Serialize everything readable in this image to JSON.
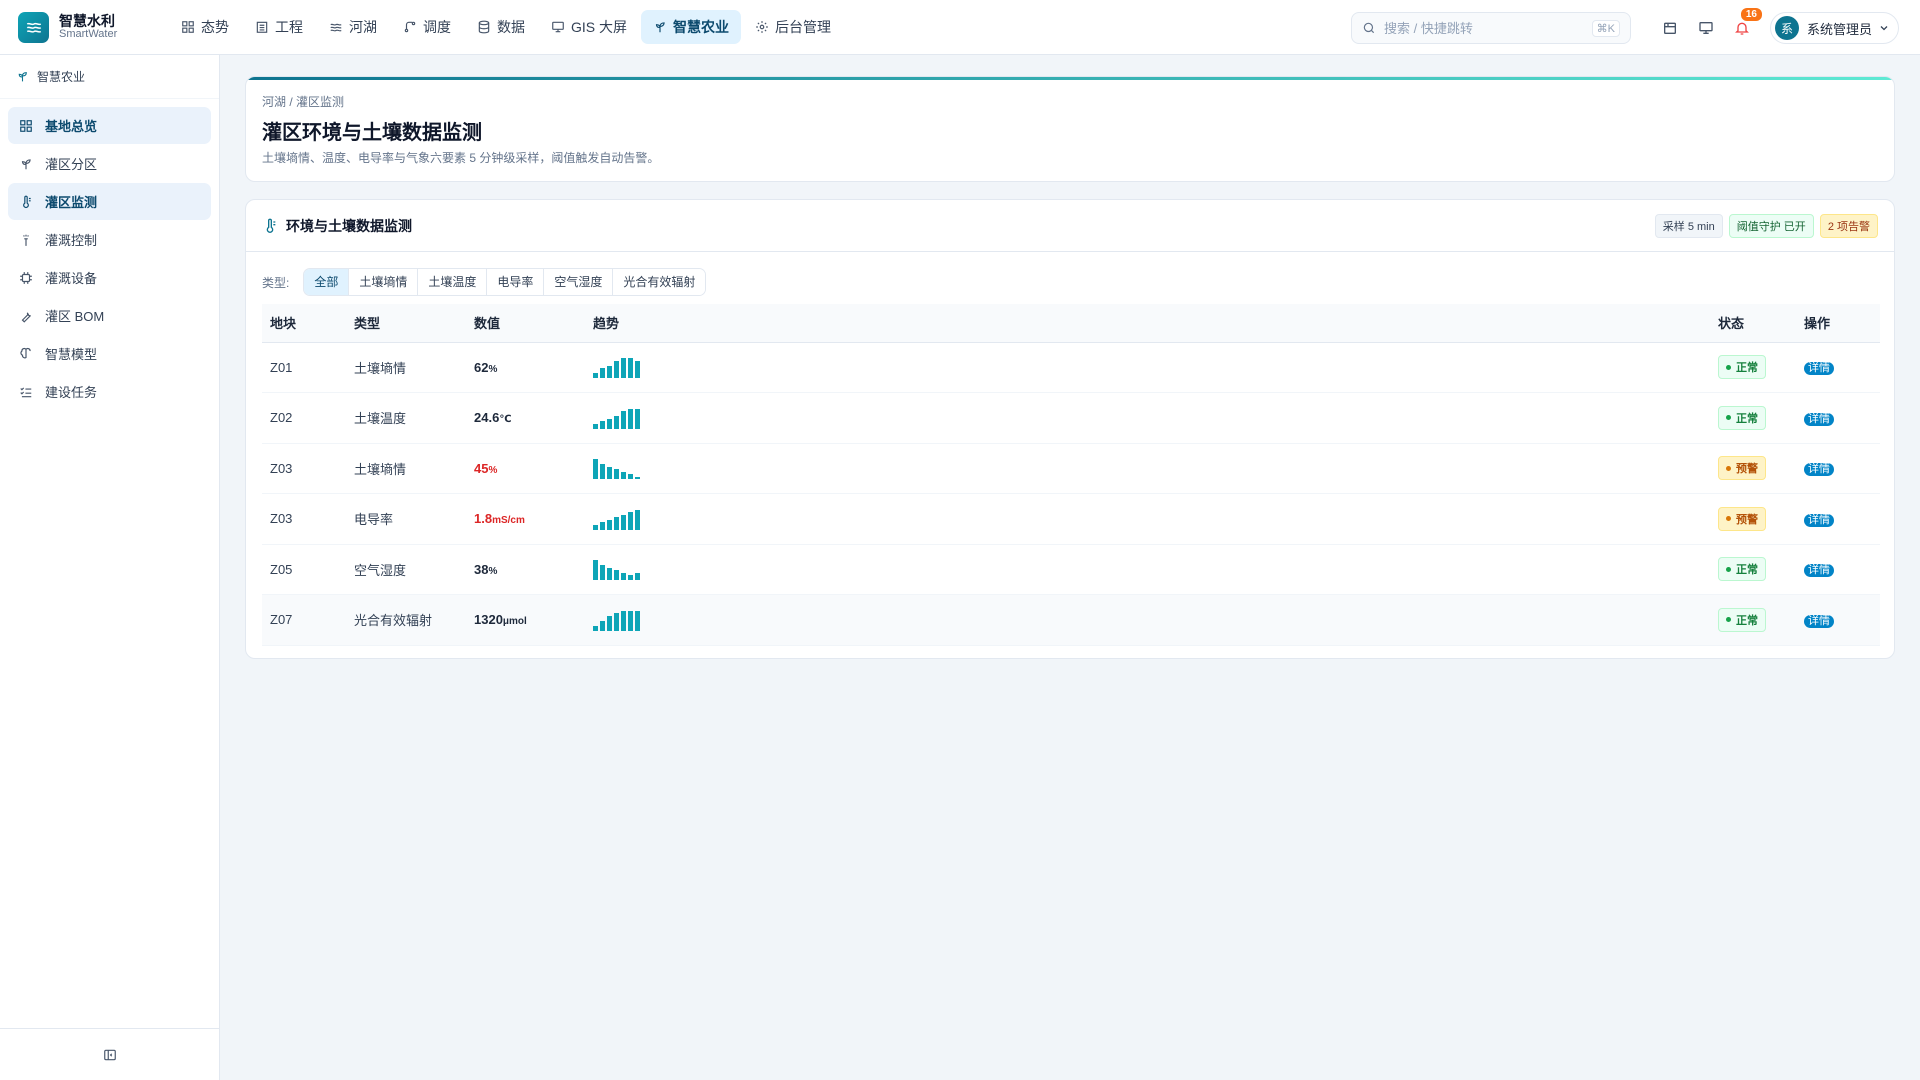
{
  "brand": {
    "title": "智慧水利",
    "subtitle": "SmartWater"
  },
  "nav": [
    {
      "label": "态势",
      "icon": "grid-icon"
    },
    {
      "label": "工程",
      "icon": "building-icon"
    },
    {
      "label": "河湖",
      "icon": "waves-icon"
    },
    {
      "label": "调度",
      "icon": "branch-icon"
    },
    {
      "label": "数据",
      "icon": "database-icon"
    },
    {
      "label": "GIS 大屏",
      "icon": "monitor-icon"
    },
    {
      "label": "智慧农业",
      "icon": "sprout-icon",
      "active": true
    },
    {
      "label": "后台管理",
      "icon": "gear-icon"
    }
  ],
  "search": {
    "placeholder": "搜索 / 快捷跳转",
    "shortcut": "⌘K"
  },
  "notifications": {
    "count": "16"
  },
  "user": {
    "avatar_text": "系",
    "name": "系统管理员"
  },
  "sidebar": {
    "header": "智慧农业",
    "items": [
      {
        "label": "基地总览",
        "active": true
      },
      {
        "label": "灌区分区"
      },
      {
        "label": "灌区监测",
        "active": true
      },
      {
        "label": "灌溉控制"
      },
      {
        "label": "灌溉设备"
      },
      {
        "label": "灌区 BOM"
      },
      {
        "label": "智慧模型"
      },
      {
        "label": "建设任务"
      }
    ]
  },
  "page": {
    "breadcrumb": "河湖 / 灌区监测",
    "title": "灌区环境与土壤数据监测",
    "description": "土壤墒情、温度、电导率与气象六要素 5 分钟级采样，阈值触发自动告警。"
  },
  "panel": {
    "title": "环境与土壤数据监测",
    "tags": [
      {
        "label": "采样 5 min",
        "tone": "gray"
      },
      {
        "label": "阈值守护 已开",
        "tone": "green"
      },
      {
        "label": "2 项告警",
        "tone": "orange"
      }
    ],
    "filter_label": "类型:",
    "filters": [
      {
        "label": "全部",
        "active": true
      },
      {
        "label": "土壤墒情"
      },
      {
        "label": "土壤温度"
      },
      {
        "label": "电导率"
      },
      {
        "label": "空气湿度"
      },
      {
        "label": "光合有效辐射"
      }
    ],
    "columns": {
      "plot": "地块",
      "type": "类型",
      "value": "数值",
      "trend": "趋势",
      "status": "状态",
      "action": "操作"
    },
    "rows": [
      {
        "plot": "Z01",
        "type": "土壤墒情",
        "value": "62",
        "unit": "%",
        "warn": false,
        "trend": [
          2,
          4,
          5,
          7,
          8,
          8,
          7
        ],
        "status": "正常",
        "action": "详情"
      },
      {
        "plot": "Z02",
        "type": "土壤温度",
        "value": "24.6",
        "unit": "℃",
        "warn": false,
        "trend": [
          2,
          3,
          4,
          5,
          7,
          8,
          8
        ],
        "status": "正常",
        "action": "详情"
      },
      {
        "plot": "Z03",
        "type": "土壤墒情",
        "value": "45",
        "unit": "%",
        "warn": true,
        "trend": [
          8,
          6,
          5,
          4,
          3,
          2,
          1
        ],
        "status": "预警",
        "action": "详情"
      },
      {
        "plot": "Z03",
        "type": "电导率",
        "value": "1.8",
        "unit": "mS/cm",
        "warn": true,
        "trend": [
          2,
          3,
          4,
          5,
          6,
          7,
          8
        ],
        "status": "预警",
        "action": "详情"
      },
      {
        "plot": "Z05",
        "type": "空气湿度",
        "value": "38",
        "unit": "%",
        "warn": false,
        "trend": [
          8,
          6,
          5,
          4,
          3,
          2,
          3
        ],
        "status": "正常",
        "action": "详情"
      },
      {
        "plot": "Z07",
        "type": "光合有效辐射",
        "value": "1320",
        "unit": "μmol",
        "warn": false,
        "trend": [
          2,
          4,
          6,
          7,
          8,
          8,
          8
        ],
        "status": "正常",
        "action": "详情"
      }
    ]
  },
  "colors": {
    "accent": "#0e7490",
    "spark": "#0ea5b7",
    "warn_value": "#dc2626"
  }
}
